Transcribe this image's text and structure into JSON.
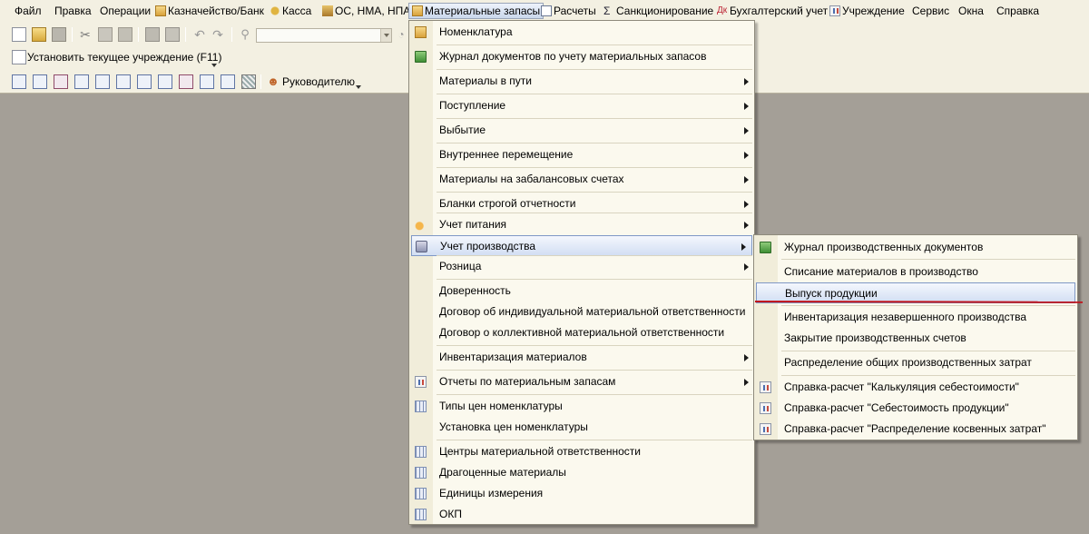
{
  "menubar": {
    "items": [
      {
        "label": "Файл",
        "icon": ""
      },
      {
        "label": "Правка",
        "icon": ""
      },
      {
        "label": "Операции",
        "icon": ""
      },
      {
        "label": "Казначейство/Банк",
        "icon": "treasury-icon"
      },
      {
        "label": "Касса",
        "icon": "cash-icon"
      },
      {
        "label": "ОС, НМА, НПА",
        "icon": "assets-icon"
      },
      {
        "label": "Материальные запасы",
        "icon": "materials-icon"
      },
      {
        "label": "Расчеты",
        "icon": "settlements-icon"
      },
      {
        "label": "Санкционирование",
        "icon": "sigma-icon"
      },
      {
        "label": "Бухгалтерский учет",
        "icon": "accounting-icon"
      },
      {
        "label": "Учреждение",
        "icon": "institution-icon"
      },
      {
        "label": "Сервис",
        "icon": ""
      },
      {
        "label": "Окна",
        "icon": ""
      },
      {
        "label": "Справка",
        "icon": ""
      }
    ]
  },
  "toolbar2": {
    "set_institution_label": "Установить текущее учреждение (F11)"
  },
  "toolbar3": {
    "managers_label": "Руководителю"
  },
  "materials_menu": {
    "items": [
      {
        "label": "Номенклатура",
        "icon": "table-icon",
        "submenu": false
      },
      {
        "label": "Журнал документов по учету материальных запасов",
        "icon": "journal-icon",
        "submenu": false
      },
      {
        "label": "Материалы в пути",
        "icon": "",
        "submenu": true
      },
      {
        "label": "Поступление",
        "icon": "",
        "submenu": true
      },
      {
        "label": "Выбытие",
        "icon": "",
        "submenu": true
      },
      {
        "label": "Внутреннее перемещение",
        "icon": "",
        "submenu": true
      },
      {
        "label": "Материалы на забалансовых счетах",
        "icon": "",
        "submenu": true
      },
      {
        "label": "Бланки строгой отчетности",
        "icon": "",
        "submenu": true
      },
      {
        "label": "Учет питания",
        "icon": "food-icon",
        "submenu": true
      },
      {
        "label": "Учет производства",
        "icon": "production-icon",
        "submenu": true
      },
      {
        "label": "Розница",
        "icon": "",
        "submenu": true
      },
      {
        "label": "Доверенность",
        "icon": "",
        "submenu": false
      },
      {
        "label": "Договор об индивидуальной материальной ответственности",
        "icon": "",
        "submenu": false
      },
      {
        "label": "Договор о коллективной материальной ответственности",
        "icon": "",
        "submenu": false
      },
      {
        "label": "Инвентаризация материалов",
        "icon": "",
        "submenu": true
      },
      {
        "label": "Отчеты по материальным запасам",
        "icon": "report-icon",
        "submenu": true
      },
      {
        "label": "Типы цен номенклатуры",
        "icon": "grid-icon",
        "submenu": false
      },
      {
        "label": "Установка цен номенклатуры",
        "icon": "",
        "submenu": false
      },
      {
        "label": "Центры материальной ответственности",
        "icon": "grid-icon",
        "submenu": false
      },
      {
        "label": "Драгоценные материалы",
        "icon": "grid-icon",
        "submenu": false
      },
      {
        "label": "Единицы измерения",
        "icon": "grid-icon",
        "submenu": false
      },
      {
        "label": "ОКП",
        "icon": "grid-icon",
        "submenu": false
      }
    ]
  },
  "production_menu": {
    "items": [
      {
        "label": "Журнал производственных документов",
        "icon": "journal-icon"
      },
      {
        "label": "Списание материалов в производство",
        "icon": ""
      },
      {
        "label": "Выпуск продукции",
        "icon": ""
      },
      {
        "label": "Инвентаризация незавершенного производства",
        "icon": ""
      },
      {
        "label": "Закрытие производственных счетов",
        "icon": ""
      },
      {
        "label": "Распределение общих производственных затрат",
        "icon": ""
      },
      {
        "label": "Справка-расчет \"Калькуляция себестоимости\"",
        "icon": "report-icon"
      },
      {
        "label": "Справка-расчет \"Себестоимость продукции\"",
        "icon": "report-icon"
      },
      {
        "label": "Справка-расчет \"Распределение косвенных затрат\"",
        "icon": "report-icon"
      }
    ]
  },
  "colors": {
    "workspace": "#a49f97",
    "toolbar_bg": "#f3f0e2",
    "menu_bg": "#fbf9ee",
    "highlight": "#d2def3",
    "annotation_red": "#c0141c"
  }
}
